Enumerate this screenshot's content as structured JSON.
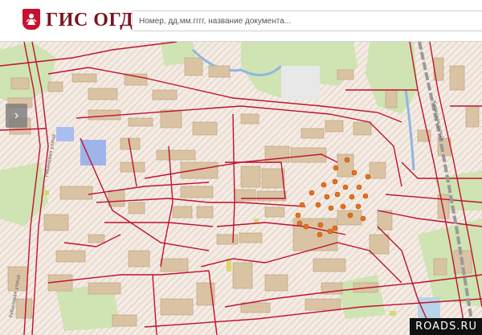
{
  "header": {
    "logo_text": "ГИС ОГД",
    "search_placeholder": "Номер, дд.мм.гггг, название документа..."
  },
  "map": {
    "nav_arrow": "›",
    "road_labels": [
      "Рябиновая улица",
      "Рябиновая улица",
      "Киевское шоссе"
    ],
    "colors": {
      "boundary": "#c0112e",
      "building": "#d9c3a3",
      "greenery": "#cfe3b3",
      "water": "#9fb5ea",
      "marker": "#e8701a"
    }
  },
  "watermark": "ROADS.RU"
}
